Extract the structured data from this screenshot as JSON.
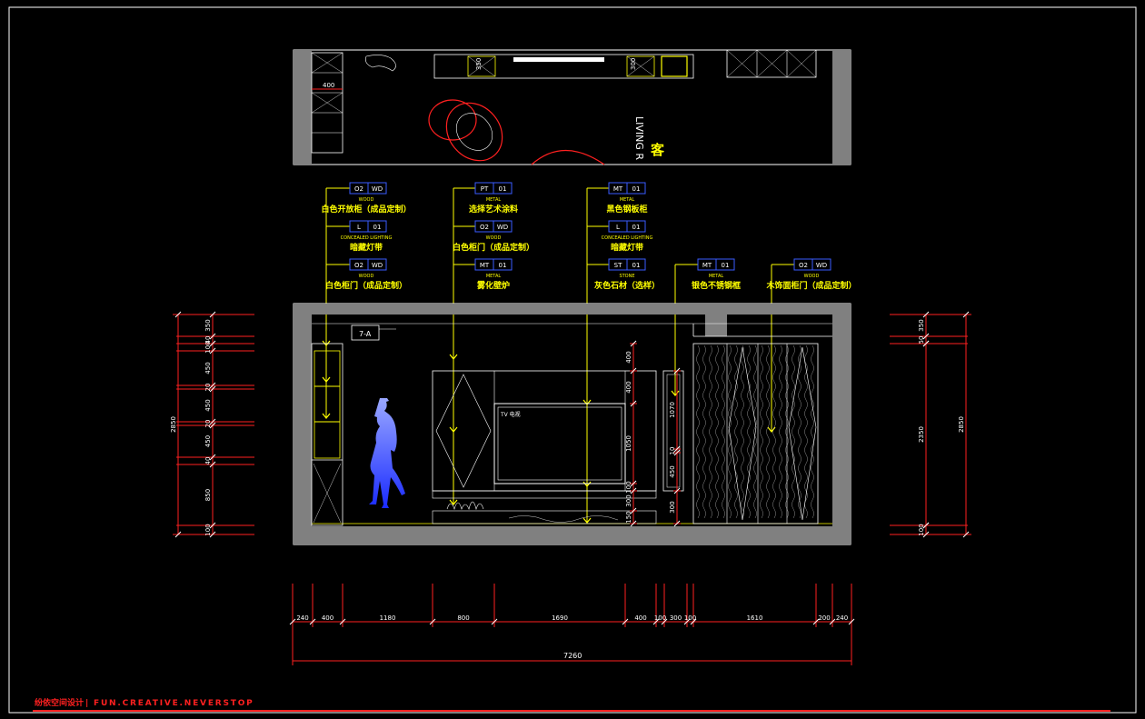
{
  "plan": {
    "room_label": "LIVING R",
    "room_char": "客",
    "dim_400": "400",
    "dim_350": "350",
    "dim_300": "300"
  },
  "callouts": [
    {
      "code": "O2",
      "sub": "WD",
      "category": "WOOD",
      "label": "白色开放柜（成品定制）"
    },
    {
      "code": "L",
      "sub": "01",
      "category": "CONCEALED LIGHTING",
      "label": "暗藏灯带"
    },
    {
      "code": "O2",
      "sub": "WD",
      "category": "WOOD",
      "label": "白色柜门（成品定制）"
    },
    {
      "code": "PT",
      "sub": "01",
      "category": "METAL",
      "label": "选择艺术涂料"
    },
    {
      "code": "O2",
      "sub": "WD",
      "category": "WOOD",
      "label": "白色柜门（成品定制）"
    },
    {
      "code": "MT",
      "sub": "01",
      "category": "METAL",
      "label": "雾化壁炉"
    },
    {
      "code": "MT",
      "sub": "01",
      "category": "METAL",
      "label": "黑色钢板柜"
    },
    {
      "code": "L",
      "sub": "01",
      "category": "CONCEALED LIGHTING",
      "label": "暗藏灯带"
    },
    {
      "code": "ST",
      "sub": "01",
      "category": "STONE",
      "label": "灰色石材（选样）"
    },
    {
      "code": "MT",
      "sub": "01",
      "category": "METAL",
      "label": "银色不锈钢框"
    },
    {
      "code": "O2",
      "sub": "WD",
      "category": "WOOD",
      "label": "木饰面柜门（成品定制）"
    }
  ],
  "elevation": {
    "tag": "7-A",
    "tv_text": "TV 电视",
    "left_dims": [
      "350",
      "40",
      "100",
      "450",
      "20",
      "450",
      "20",
      "450",
      "40",
      "850",
      "100"
    ],
    "left_total": "2850",
    "right_dims": [
      "350",
      "50"
    ],
    "right_mid": "2350",
    "right_total": "2850",
    "right_bottom": "100",
    "center_dims": [
      "400",
      "400",
      "1050",
      "100",
      "300",
      "150"
    ],
    "right_col_dims": [
      "1070",
      "10",
      "450",
      "300"
    ]
  },
  "bottom_dims": {
    "segments": [
      "240",
      "400",
      "1180",
      "800",
      "1690",
      "400",
      "100",
      "300",
      "100",
      "1610",
      "200",
      "240"
    ],
    "total": "7260"
  },
  "footer": {
    "brand": "纷依空间设计",
    "slogan": "FUN.CREATIVE.NEVERSTOP"
  },
  "colors": {
    "background": "#000000",
    "primary_line": "#ffff00",
    "dimension": "#ff2020",
    "wall": "#ffffff",
    "figure": "#3a5cff",
    "callout_box": "#3a5cff"
  }
}
